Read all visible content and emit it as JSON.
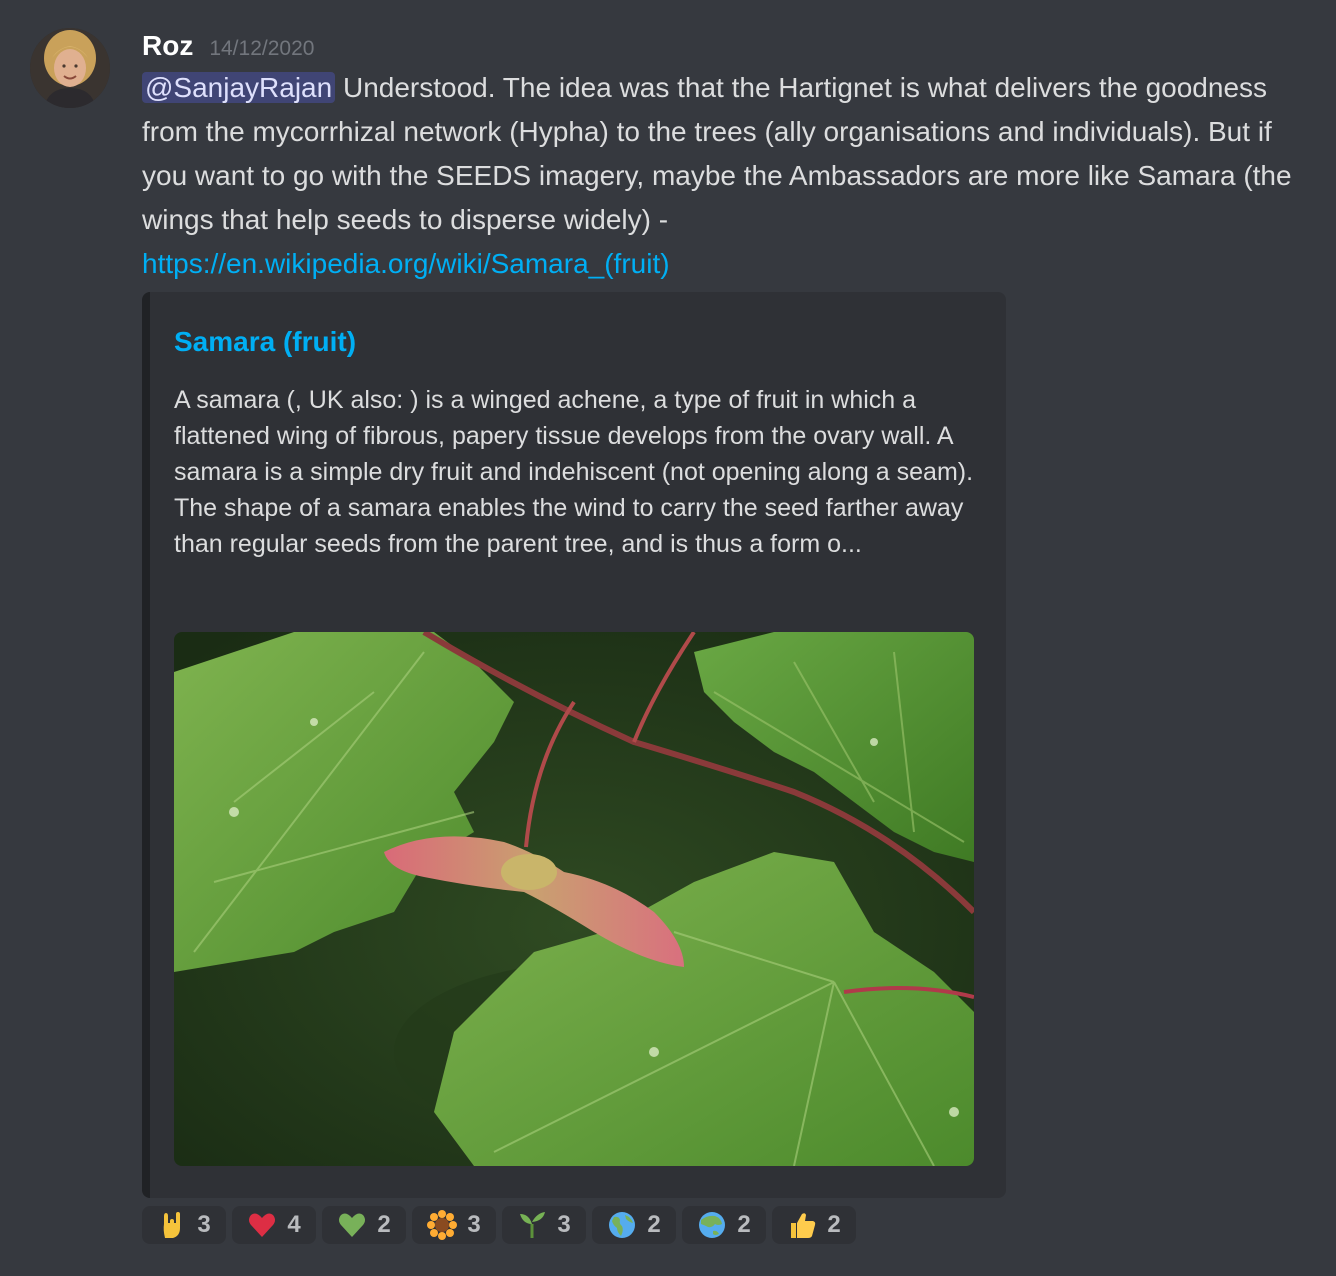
{
  "message": {
    "author": "Roz",
    "timestamp": "14/12/2020",
    "mention": "@SanjayRajan",
    "text": " Understood. The idea was that the Hartignet is what delivers the goodness from the mycorrhizal network (Hypha) to the trees (ally organisations and individuals). But if you want to go with the SEEDS imagery, maybe the Ambassadors are more like Samara (the wings that help seeds to disperse widely) -",
    "link": "https://en.wikipedia.org/wiki/Samara_(fruit)"
  },
  "embed": {
    "title": "Samara (fruit)",
    "description": "A samara (, UK also: ) is a winged achene, a type of fruit in which a flattened wing of fibrous, papery tissue develops from the ovary wall. A samara is a simple dry fruit and indehiscent (not opening along a seam). The shape of a samara enables the wind to carry the seed farther away than regular seeds from the parent tree, and is thus a form o..."
  },
  "reactions": [
    {
      "icon": "rock-hand-icon",
      "count": "3"
    },
    {
      "icon": "red-heart-icon",
      "count": "4"
    },
    {
      "icon": "green-heart-icon",
      "count": "2"
    },
    {
      "icon": "sunflower-icon",
      "count": "3"
    },
    {
      "icon": "seedling-icon",
      "count": "3"
    },
    {
      "icon": "globe-americas-icon",
      "count": "2"
    },
    {
      "icon": "globe-asia-icon",
      "count": "2"
    },
    {
      "icon": "thumbs-up-icon",
      "count": "2"
    }
  ],
  "colors": {
    "background": "#36393f",
    "embed_background": "#2f3136",
    "link": "#00aff4",
    "mention_bg": "#5865f2"
  }
}
